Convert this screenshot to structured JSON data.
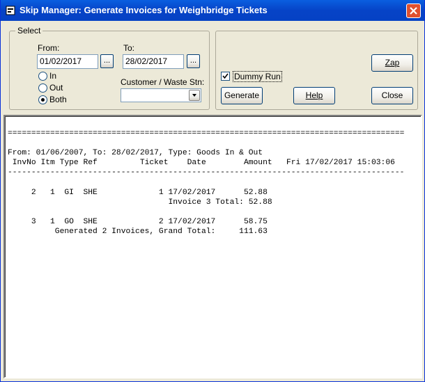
{
  "window": {
    "title": "Skip Manager: Generate Invoices for Weighbridge Tickets"
  },
  "select_group": {
    "label": "Select",
    "from_label": "From:",
    "from_value": "01/02/2017",
    "to_label": "To:",
    "to_value": "28/02/2017",
    "browse_label": "...",
    "radio_in": "In",
    "radio_out": "Out",
    "radio_both": "Both",
    "selected_radio": "Both",
    "customer_label": "Customer / Waste Stn:",
    "customer_value": ""
  },
  "actions": {
    "dummy_run_label": "Dummy Run",
    "dummy_run_checked": true,
    "zap_label": "Zap",
    "generate_label": "Generate",
    "help_label": "Help",
    "close_label": "Close"
  },
  "report": {
    "lines": [
      "====================================================================================",
      "",
      "From: 01/06/2007, To: 28/02/2017, Type: Goods In & Out",
      " InvNo Itm Type Ref         Ticket    Date        Amount   Fri 17/02/2017 15:03:06",
      "------------------------------------------------------------------------------------",
      "",
      "     2   1  GI  SHE             1 17/02/2017      52.88",
      "                                  Invoice 3 Total: 52.88",
      "",
      "     3   1  GO  SHE             2 17/02/2017      58.75",
      "          Generated 2 Invoices, Grand Total:     111.63"
    ]
  }
}
